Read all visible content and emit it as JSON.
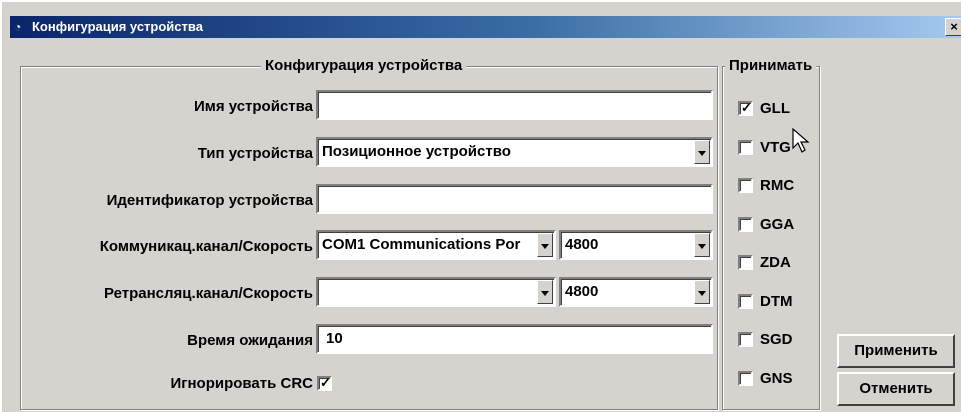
{
  "window": {
    "title": "Конфигурация устройства",
    "close_glyph": "×"
  },
  "config_group": {
    "legend": "Конфигурация устройства",
    "device_name": {
      "label": "Имя устройства",
      "value": ""
    },
    "device_type": {
      "label": "Тип устройства",
      "value": "Позиционное устройство"
    },
    "device_id": {
      "label": "Идентификатор устройства",
      "value": ""
    },
    "comm": {
      "label": "Коммуникац.канал/Скорость",
      "channel": "COM1 Communications Por",
      "speed": "4800"
    },
    "relay": {
      "label": "Ретрансляц.канал/Скорость",
      "channel": "",
      "speed": "4800"
    },
    "timeout": {
      "label": "Время ожидания",
      "value": "10"
    },
    "ignore_crc": {
      "label": "Игнорировать CRC",
      "checked": true
    }
  },
  "accept_group": {
    "legend": "Принимать",
    "items": [
      {
        "label": "GLL",
        "checked": true
      },
      {
        "label": "VTG",
        "checked": false
      },
      {
        "label": "RMC",
        "checked": false
      },
      {
        "label": "GGA",
        "checked": false
      },
      {
        "label": "ZDA",
        "checked": false
      },
      {
        "label": "DTM",
        "checked": false
      },
      {
        "label": "SGD",
        "checked": false
      },
      {
        "label": "GNS",
        "checked": false
      }
    ]
  },
  "buttons": {
    "apply": "Применить",
    "cancel": "Отменить"
  },
  "check_glyph": "✓"
}
